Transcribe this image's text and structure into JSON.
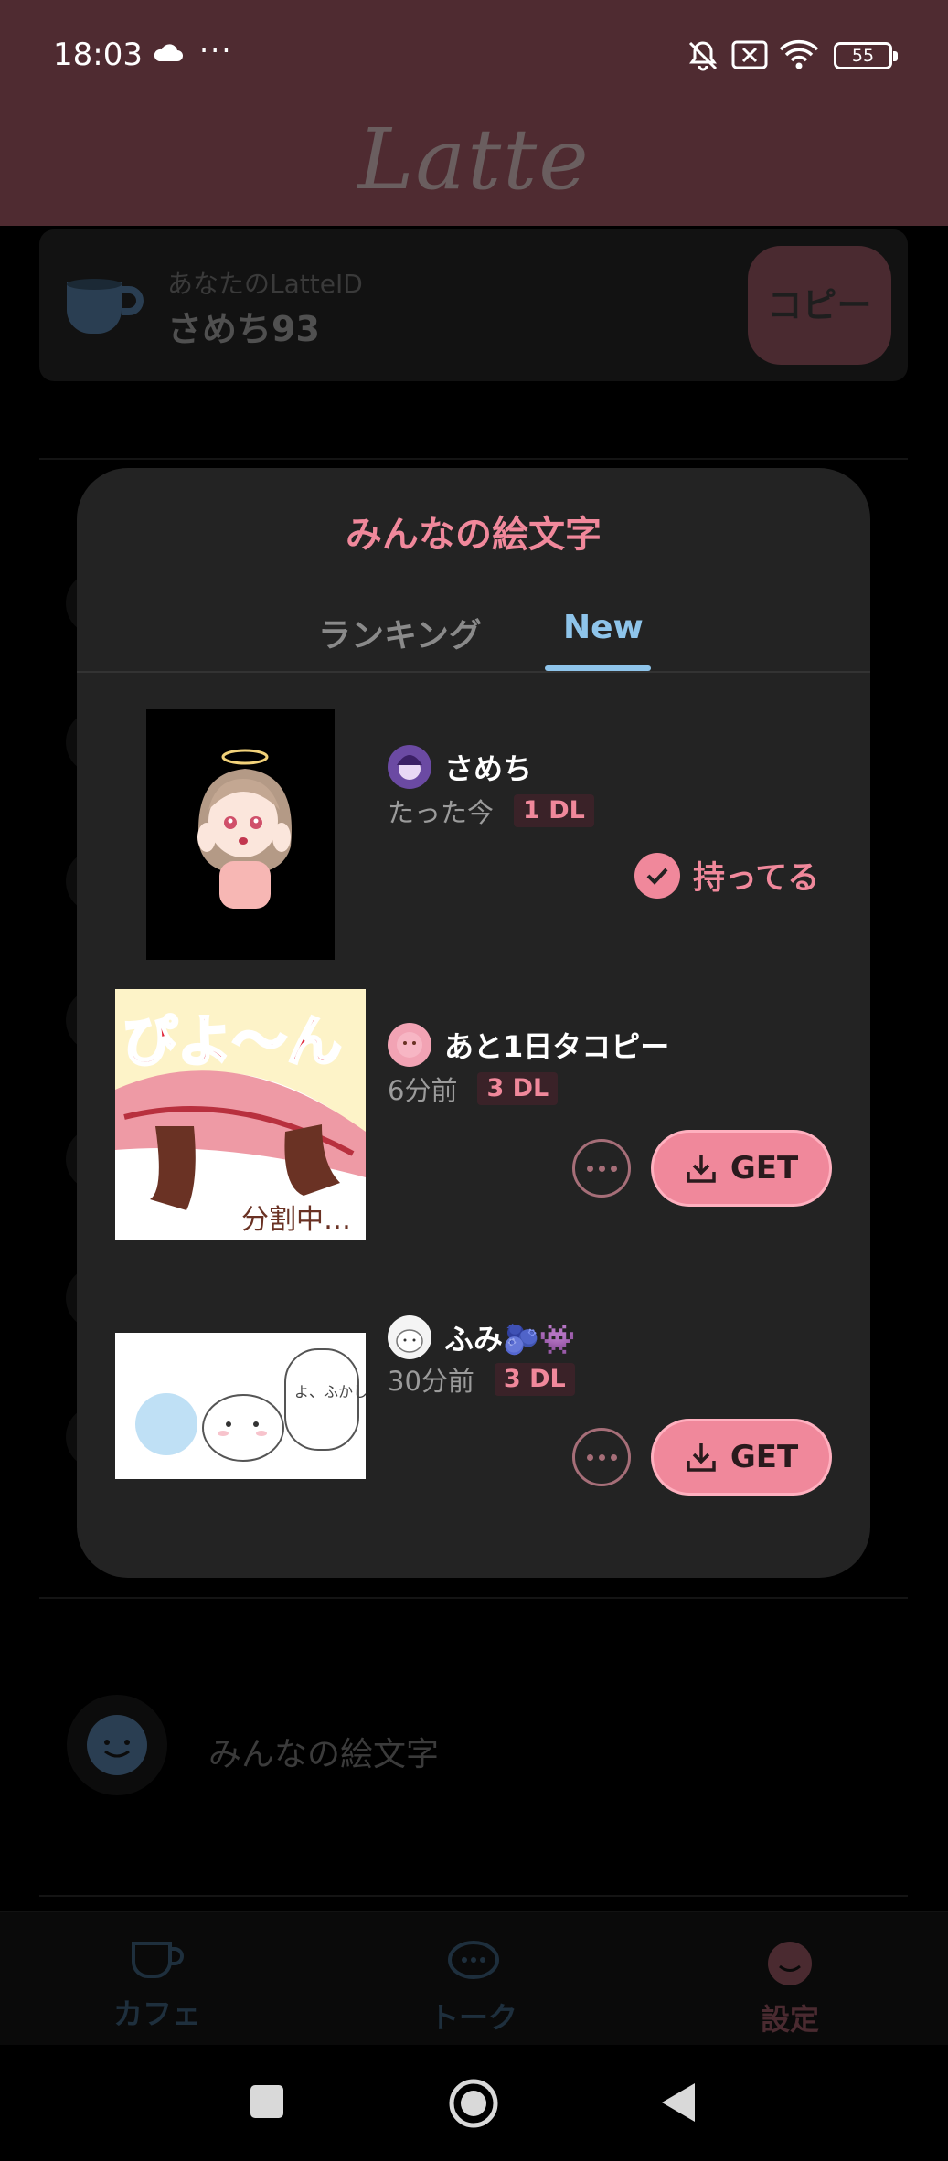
{
  "status_bar": {
    "time": "18:03",
    "battery": "55"
  },
  "app": {
    "title": "Latte"
  },
  "background": {
    "id_label": "あなたのLatteID",
    "id_value": "さめち93",
    "copy_label": "コピー",
    "emoji_row_label": "みんなの絵文字"
  },
  "tabbar": {
    "items": [
      {
        "label": "カフェ",
        "icon": "coffee-cup-icon"
      },
      {
        "label": "トーク",
        "icon": "chat-bubble-icon"
      },
      {
        "label": "設定",
        "icon": "smile-icon"
      }
    ],
    "active": 2
  },
  "modal": {
    "title": "みんなの絵文字",
    "tabs": [
      "ランキング",
      "New"
    ],
    "active_tab": 1,
    "items": [
      {
        "author": "さめち",
        "time": "たった今",
        "downloads": "1 DL",
        "owned": true,
        "owned_label": "持ってる"
      },
      {
        "author": "あと1日タコピー",
        "time": "6分前",
        "downloads": "3 DL",
        "owned": false,
        "thumb_text": "ぴよ〜ん",
        "thumb_subtext": "分割中…",
        "get_label": "GET"
      },
      {
        "author": "ふみ🫐👾",
        "time": "30分前",
        "downloads": "3 DL",
        "owned": false,
        "thumb_text": "よ、ふかし しとかる。",
        "get_label": "GET"
      }
    ]
  },
  "colors": {
    "accent": "#f0889b",
    "tab_active": "#8ec4ea",
    "header": "#4f2b31"
  }
}
